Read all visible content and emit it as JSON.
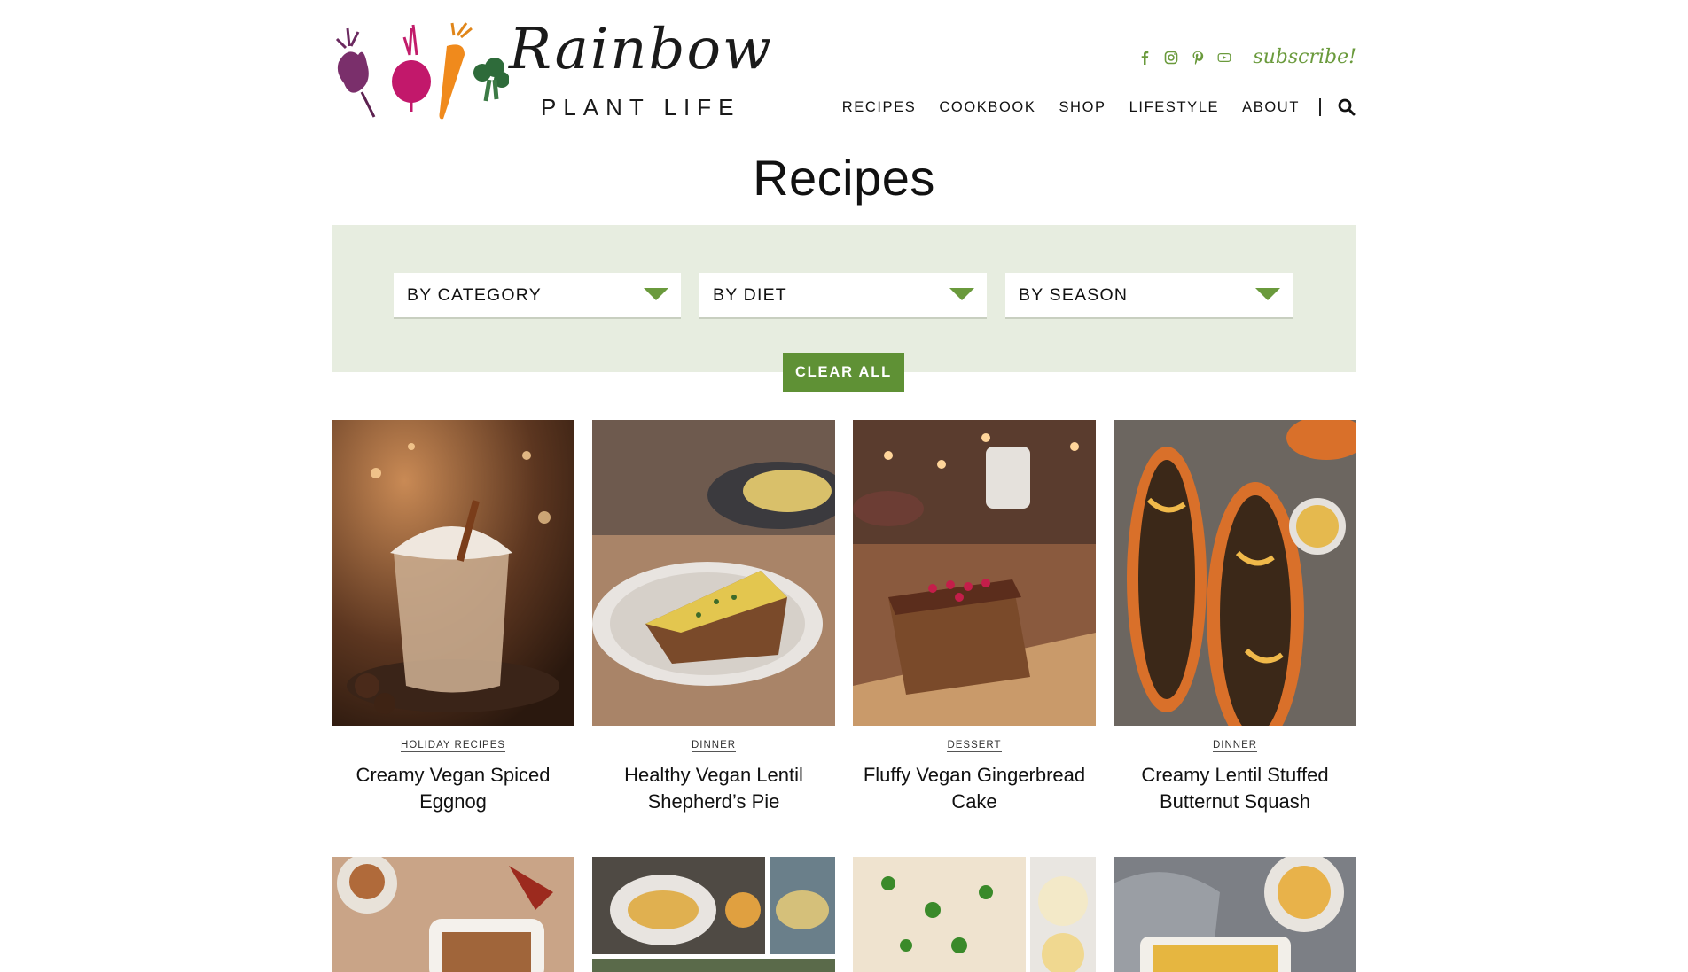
{
  "site": {
    "logo_script": "Rainbow",
    "logo_sub": "PLANT LIFE",
    "subscribe": "subscribe!",
    "social_icons": [
      "facebook-icon",
      "instagram-icon",
      "pinterest-icon",
      "youtube-icon"
    ]
  },
  "nav": {
    "items": [
      "RECIPES",
      "COOKBOOK",
      "SHOP",
      "LIFESTYLE",
      "ABOUT"
    ],
    "search_icon": "search-icon"
  },
  "page_title": "Recipes",
  "filters": {
    "category": "BY CATEGORY",
    "diet": "BY DIET",
    "season": "BY SEASON",
    "clear_all": "CLEAR ALL"
  },
  "colors": {
    "accent_green": "#5f9135",
    "filter_bg": "#e7ede0"
  },
  "recipes": [
    {
      "category": "HOLIDAY RECIPES",
      "title": "Creamy Vegan Spiced Eggnog"
    },
    {
      "category": "DINNER",
      "title": "Healthy Vegan Lentil Shepherd’s Pie"
    },
    {
      "category": "DESSERT",
      "title": "Fluffy Vegan Gingerbread Cake"
    },
    {
      "category": "DINNER",
      "title": "Creamy Lentil Stuffed Butternut Squash"
    }
  ]
}
